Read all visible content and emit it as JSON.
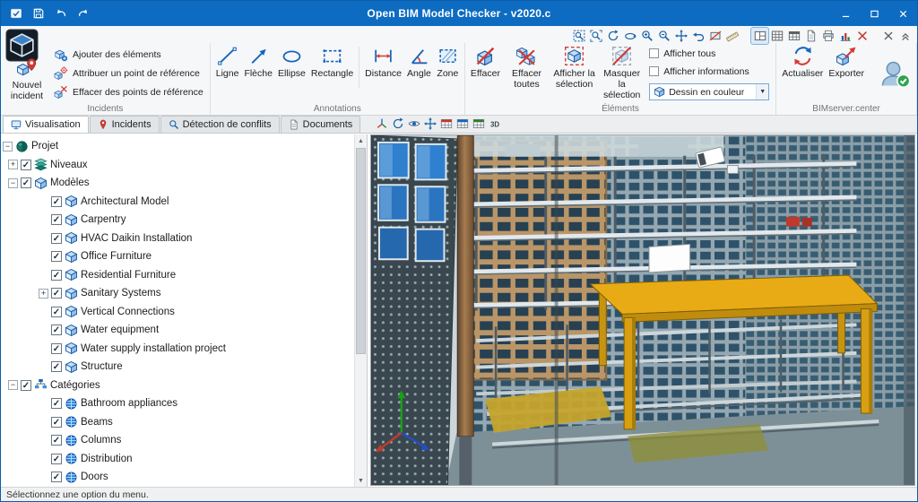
{
  "window": {
    "title": "Open BIM Model Checker - v2020.c",
    "quick_access_icons": [
      "app-badge",
      "save",
      "undo",
      "redo"
    ],
    "controls": [
      "minimize",
      "maximize",
      "close"
    ]
  },
  "top_toolbar": {
    "icons": [
      "zoom-window",
      "zoom-extents",
      "orbit",
      "rotate-view",
      "zoom-in",
      "zoom-out",
      "pan",
      "previous-view",
      "section",
      "measure",
      "viewport-layout",
      "grid",
      "tables",
      "report",
      "printer",
      "chart",
      "cut",
      "close-view",
      "collapse-ribbon"
    ],
    "active_icon": "viewport-layout"
  },
  "ribbon": {
    "incidents": {
      "label": "Incidents",
      "new_incident": "Nouvel incident",
      "items": [
        {
          "label": "Ajouter des éléments",
          "icon": "add-elements"
        },
        {
          "label": "Attribuer un point de référence",
          "icon": "assign-reference-point"
        },
        {
          "label": "Effacer des points de référence",
          "icon": "delete-reference-points"
        }
      ]
    },
    "annotations": {
      "label": "Annotations",
      "buttons": [
        {
          "label": "Ligne",
          "icon": "line"
        },
        {
          "label": "Flèche",
          "icon": "arrow"
        },
        {
          "label": "Ellipse",
          "icon": "ellipse"
        },
        {
          "label": "Rectangle",
          "icon": "rectangle"
        },
        {
          "label": "Distance",
          "icon": "distance"
        },
        {
          "label": "Angle",
          "icon": "angle"
        },
        {
          "label": "Zone",
          "icon": "zone"
        }
      ]
    },
    "elements": {
      "label": "Éléments",
      "buttons": [
        {
          "label": "Effacer",
          "icon": "erase"
        },
        {
          "label": "Effacer toutes",
          "icon": "erase-all"
        },
        {
          "label": "Afficher la sélection",
          "icon": "show-selection"
        },
        {
          "label": "Masquer la sélection",
          "icon": "hide-selection"
        }
      ],
      "checkboxes": [
        {
          "label": "Afficher tous",
          "checked": false
        },
        {
          "label": "Afficher informations",
          "checked": false
        }
      ],
      "dropdown": {
        "value": "Dessin en couleur"
      }
    },
    "bimserver": {
      "label": "BIMserver.center",
      "buttons": [
        {
          "label": "Actualiser",
          "icon": "refresh"
        },
        {
          "label": "Exporter",
          "icon": "export"
        }
      ]
    }
  },
  "tabs": [
    {
      "label": "Visualisation",
      "icon": "monitor",
      "active": true
    },
    {
      "label": "Incidents",
      "icon": "incident-pin",
      "active": false
    },
    {
      "label": "Détection de conflits",
      "icon": "magnifier",
      "active": false
    },
    {
      "label": "Documents",
      "icon": "document",
      "active": false
    }
  ],
  "viewport_toolbar": {
    "icons": [
      "projection",
      "orbit-view",
      "eye",
      "walk",
      "red-table",
      "blue-table",
      "green-table",
      "view-3d"
    ]
  },
  "tree": {
    "root": {
      "label": "Projet",
      "icon": "project",
      "expander": "minus"
    },
    "nodes": [
      {
        "label": "Niveaux",
        "icon": "levels",
        "expander": "plus",
        "checked": true
      },
      {
        "label": "Modèles",
        "icon": "model",
        "expander": "minus",
        "checked": true,
        "children": [
          {
            "label": "Architectural Model",
            "icon": "cube",
            "checked": true
          },
          {
            "label": "Carpentry",
            "icon": "cube",
            "checked": true
          },
          {
            "label": "HVAC Daikin Installation",
            "icon": "cube",
            "checked": true
          },
          {
            "label": "Office Furniture",
            "icon": "cube",
            "checked": true
          },
          {
            "label": "Residential Furniture",
            "icon": "cube",
            "checked": true
          },
          {
            "label": "Sanitary Systems",
            "icon": "cube",
            "checked": true,
            "expander": "plus"
          },
          {
            "label": "Vertical Connections",
            "icon": "cube",
            "checked": true
          },
          {
            "label": "Water equipment",
            "icon": "cube",
            "checked": true
          },
          {
            "label": "Water supply installation project",
            "icon": "cube",
            "checked": true
          },
          {
            "label": "Structure",
            "icon": "cube",
            "checked": true
          }
        ]
      },
      {
        "label": "Catégories",
        "icon": "categories",
        "expander": "minus",
        "checked": true,
        "children": [
          {
            "label": "Bathroom appliances",
            "icon": "category",
            "checked": true
          },
          {
            "label": "Beams",
            "icon": "category",
            "checked": true
          },
          {
            "label": "Columns",
            "icon": "category",
            "checked": true
          },
          {
            "label": "Distribution",
            "icon": "category",
            "checked": true
          },
          {
            "label": "Doors",
            "icon": "category",
            "checked": true
          }
        ]
      }
    ]
  },
  "statusbar": {
    "text": "Sélectionnez une option du menu."
  },
  "colors": {
    "titlebar": "#0d6cc1",
    "accent_blue": "#1565c0",
    "accent_red": "#d23b32",
    "table_yellow": "#e8ab15",
    "axis_green": "#17a017",
    "axis_red": "#c23b2e",
    "axis_blue": "#2050c8"
  }
}
